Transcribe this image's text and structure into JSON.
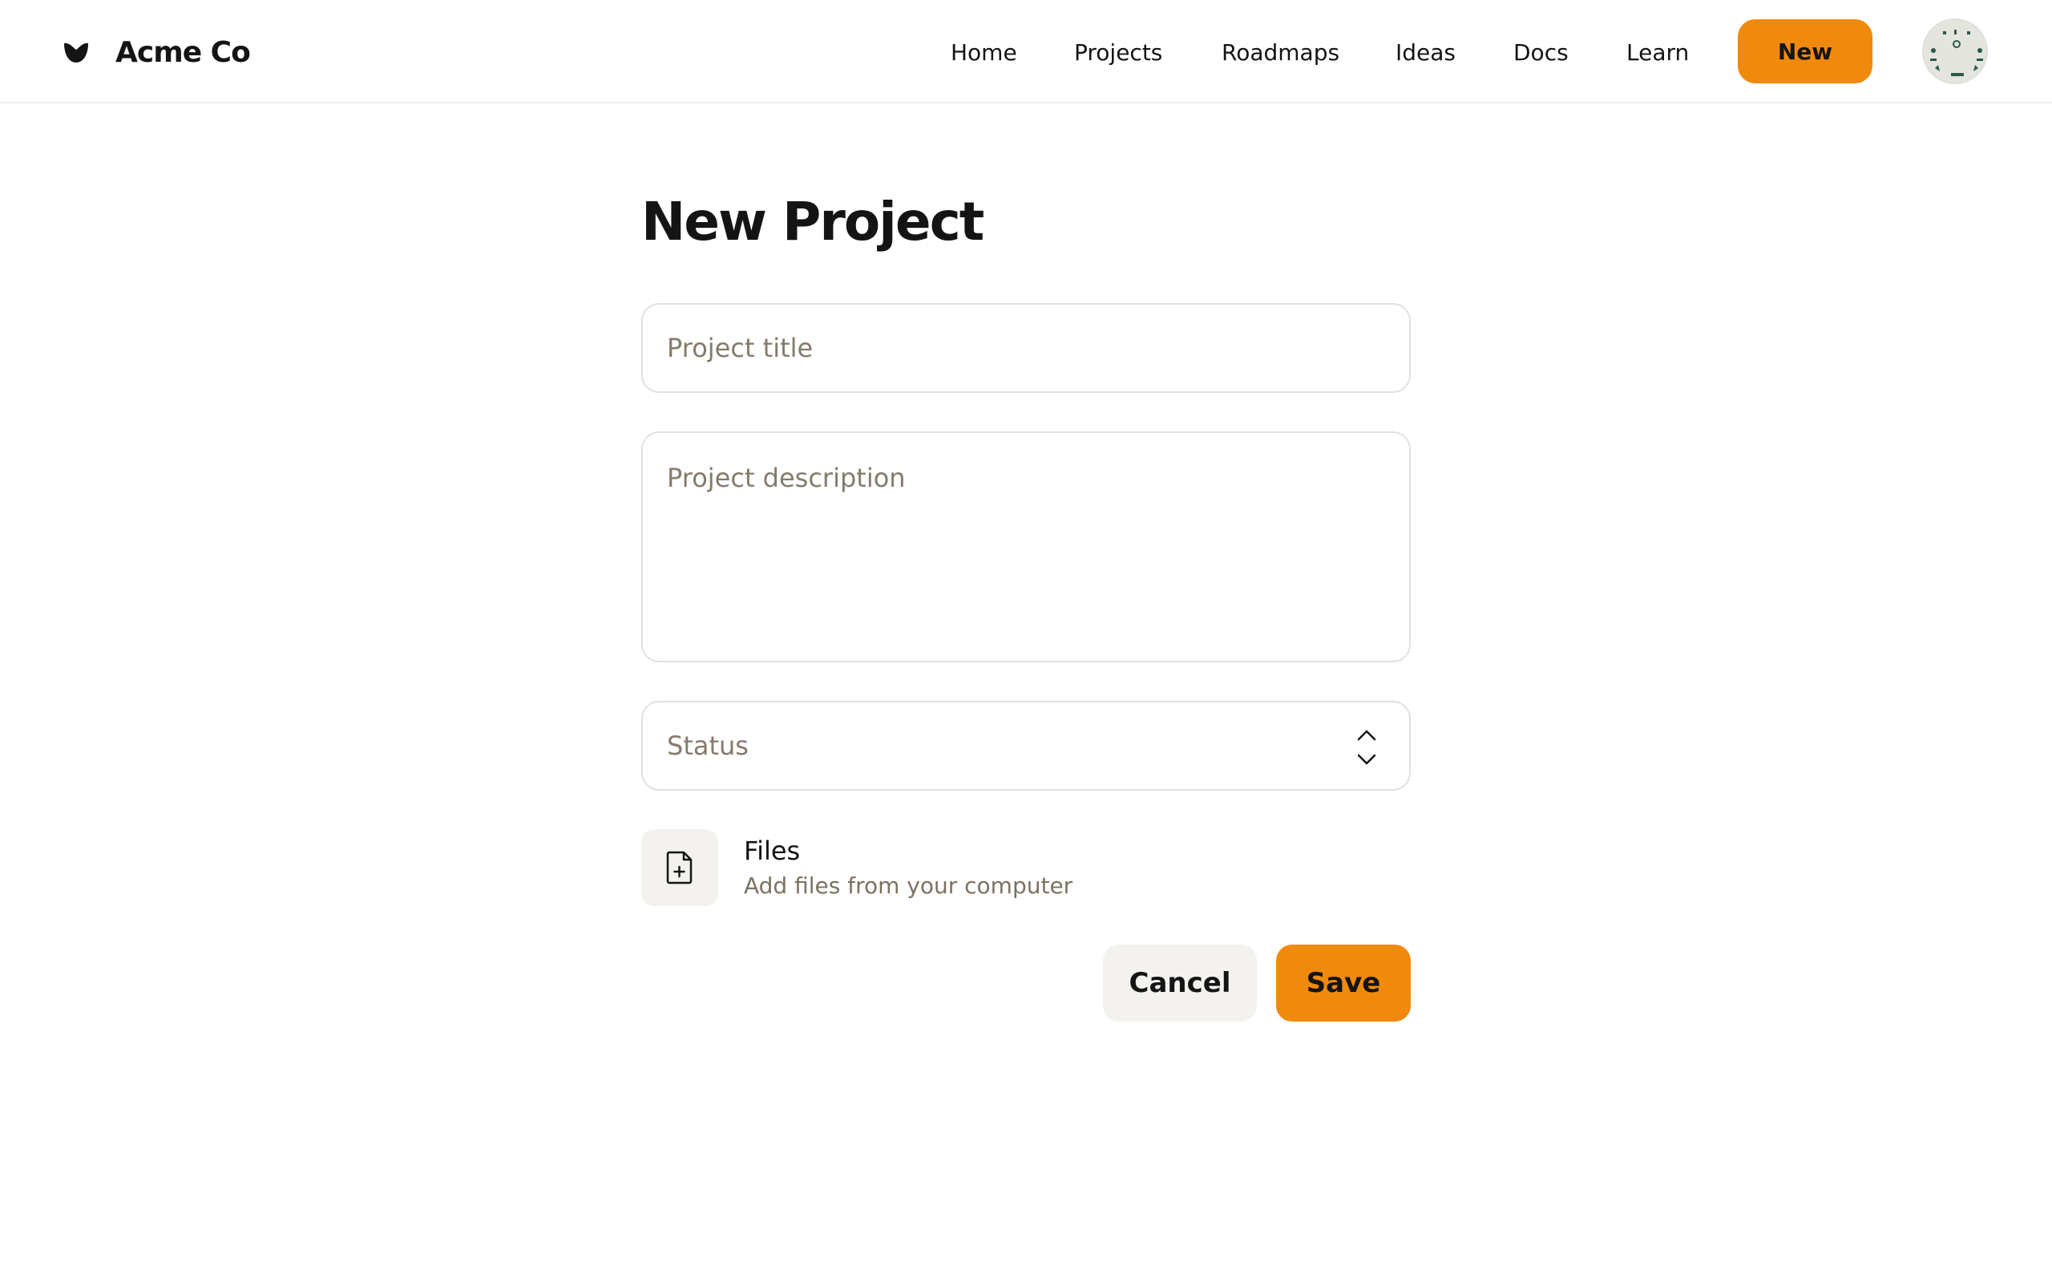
{
  "header": {
    "brand_name": "Acme Co",
    "nav": [
      "Home",
      "Projects",
      "Roadmaps",
      "Ideas",
      "Docs",
      "Learn"
    ],
    "new_button_label": "New",
    "accent_color": "#f08a0c"
  },
  "form": {
    "page_title": "New Project",
    "title_placeholder": "Project title",
    "description_placeholder": "Project description",
    "status_placeholder": "Status",
    "files_title": "Files",
    "files_subtitle": "Add files from your computer",
    "cancel_label": "Cancel",
    "save_label": "Save"
  },
  "icons": {
    "brand": "acme-leaf-logo",
    "status": "chevron-up-down-icon",
    "files": "file-plus-icon"
  }
}
